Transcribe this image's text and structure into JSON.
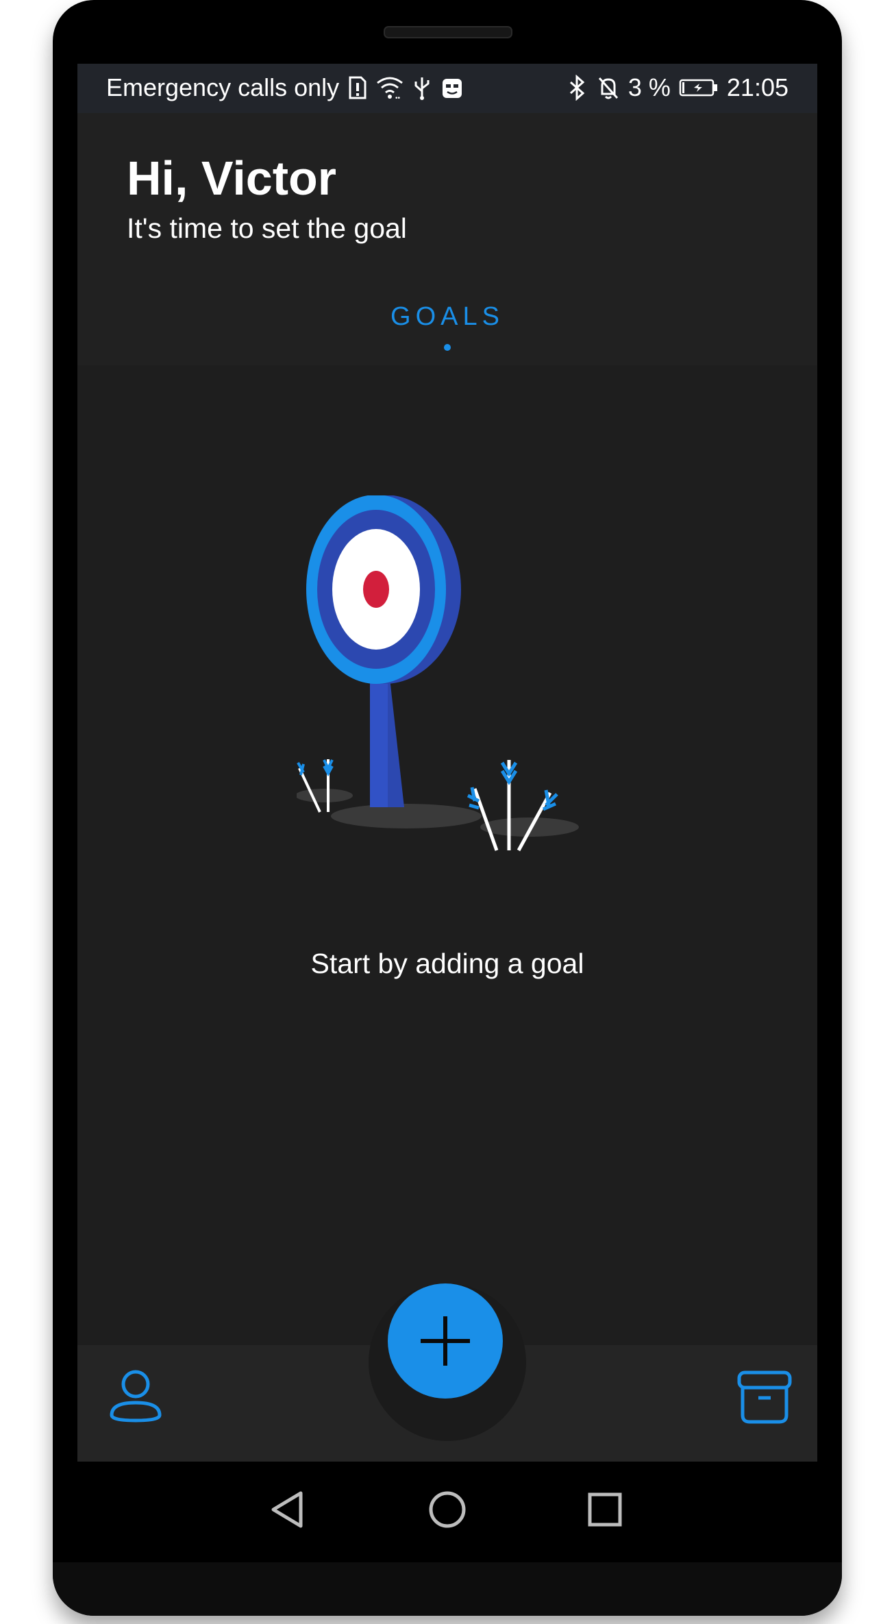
{
  "status_bar": {
    "carrier_text": "Emergency calls only",
    "battery_text": "3 %",
    "time": "21:05",
    "icons_left": [
      "sim-alert-icon",
      "wifi-icon",
      "usb-icon",
      "cat-face-icon"
    ],
    "icons_right": [
      "bluetooth-icon",
      "bell-off-icon",
      "battery-charging-icon"
    ]
  },
  "header": {
    "greeting": "Hi, Victor",
    "subtitle": "It's time to set the goal"
  },
  "tabs": [
    {
      "label": "GOALS",
      "active": true
    }
  ],
  "empty_state": {
    "message": "Start by adding a goal",
    "illustration": "target-with-arrows-illustration"
  },
  "bottom_nav": {
    "left_icon": "profile-icon",
    "fab_icon": "plus-icon",
    "right_icon": "archive-icon"
  },
  "android_nav": {
    "keys": [
      "back-icon",
      "home-icon",
      "recents-icon"
    ]
  },
  "colors": {
    "accent": "#1a8fe8",
    "background": "#1e1e1e",
    "header": "#212121",
    "status_bar": "#22252b",
    "target_red": "#d21f3c",
    "target_blue_dark": "#2c48b0"
  }
}
